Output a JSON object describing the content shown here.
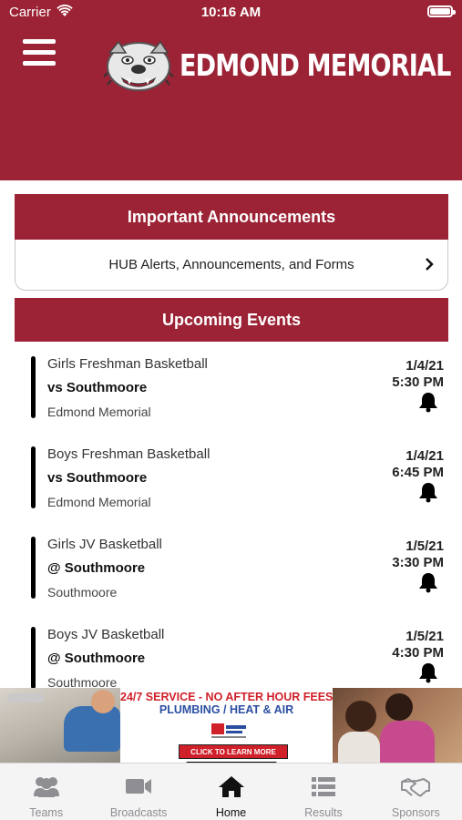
{
  "status_bar": {
    "carrier": "Carrier",
    "time": "10:16 AM"
  },
  "header": {
    "school_name": "EDMOND MEMORIAL",
    "brand_color": "#9b2335"
  },
  "announcements": {
    "title": "Important Announcements",
    "link_label": "HUB Alerts, Announcements, and Forms"
  },
  "events": {
    "title": "Upcoming Events",
    "items": [
      {
        "name": "Girls Freshman Basketball",
        "opponent": "vs Southmoore",
        "location": "Edmond Memorial",
        "date": "1/4/21",
        "time": "5:30 PM"
      },
      {
        "name": "Boys Freshman Basketball",
        "opponent": "vs Southmoore",
        "location": "Edmond Memorial",
        "date": "1/4/21",
        "time": "6:45 PM"
      },
      {
        "name": "Girls JV Basketball",
        "opponent": "@ Southmoore",
        "location": "Southmoore",
        "date": "1/5/21",
        "time": "3:30 PM"
      },
      {
        "name": "Boys JV Basketball",
        "opponent": "@ Southmoore",
        "location": "Southmoore",
        "date": "1/5/21",
        "time": "4:30 PM"
      }
    ]
  },
  "ad": {
    "headline": "24/7 SERVICE - NO AFTER HOUR FEES",
    "subheadline": "PLUMBING / HEAT & AIR",
    "button": "CLICK TO LEARN MORE"
  },
  "tabs": [
    {
      "label": "Teams",
      "icon": "people-icon"
    },
    {
      "label": "Broadcasts",
      "icon": "video-camera-icon"
    },
    {
      "label": "Home",
      "icon": "home-icon",
      "active": true
    },
    {
      "label": "Results",
      "icon": "list-icon"
    },
    {
      "label": "Sponsors",
      "icon": "handshake-icon"
    }
  ]
}
